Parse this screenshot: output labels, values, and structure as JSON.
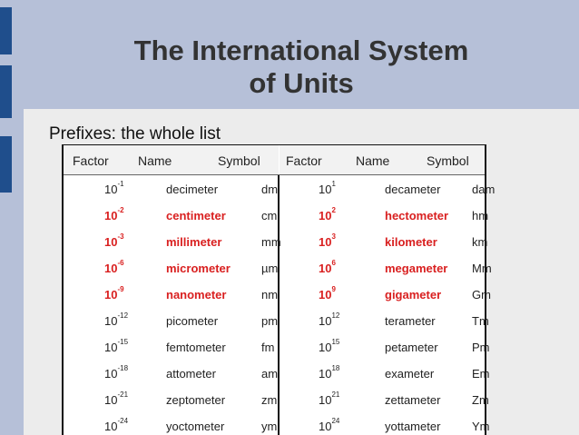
{
  "title": "The International System of Units",
  "title_lines": [
    "The International System",
    "of Units"
  ],
  "subtitle": "Prefixes: the whole list",
  "headers": [
    "Factor",
    "Name",
    "Symbol",
    "Factor",
    "Name",
    "Symbol"
  ],
  "colors": {
    "highlight": "#d92020",
    "text": "#222222",
    "band": "#b6c0d8",
    "marker": "#1f4e8c"
  },
  "rows": [
    {
      "highlight": false,
      "left": {
        "base": "10",
        "exp": "-1",
        "name": "decimeter",
        "symbol": "dm"
      },
      "right": {
        "base": "10",
        "exp": "1",
        "name": "decameter",
        "symbol": "dam"
      }
    },
    {
      "highlight": true,
      "left": {
        "base": "10",
        "exp": "-2",
        "name": "centimeter",
        "symbol": "cm"
      },
      "right": {
        "base": "10",
        "exp": "2",
        "name": "hectometer",
        "symbol": "hm"
      }
    },
    {
      "highlight": true,
      "left": {
        "base": "10",
        "exp": "-3",
        "name": "millimeter",
        "symbol": "mm"
      },
      "right": {
        "base": "10",
        "exp": "3",
        "name": "kilometer",
        "symbol": "km"
      }
    },
    {
      "highlight": true,
      "left": {
        "base": "10",
        "exp": "-6",
        "name": "micrometer",
        "symbol": "µm"
      },
      "right": {
        "base": "10",
        "exp": "6",
        "name": "megameter",
        "symbol": "Mm"
      }
    },
    {
      "highlight": true,
      "left": {
        "base": "10",
        "exp": "-9",
        "name": "nanometer",
        "symbol": "nm"
      },
      "right": {
        "base": "10",
        "exp": "9",
        "name": "gigameter",
        "symbol": "Gm"
      }
    },
    {
      "highlight": false,
      "left": {
        "base": "10",
        "exp": "-12",
        "name": "picometer",
        "symbol": "pm"
      },
      "right": {
        "base": "10",
        "exp": "12",
        "name": "terameter",
        "symbol": "Tm"
      }
    },
    {
      "highlight": false,
      "left": {
        "base": "10",
        "exp": "-15",
        "name": "femtometer",
        "symbol": "fm"
      },
      "right": {
        "base": "10",
        "exp": "15",
        "name": "petameter",
        "symbol": "Pm"
      }
    },
    {
      "highlight": false,
      "left": {
        "base": "10",
        "exp": "-18",
        "name": "attometer",
        "symbol": "am"
      },
      "right": {
        "base": "10",
        "exp": "18",
        "name": "exameter",
        "symbol": "Em"
      }
    },
    {
      "highlight": false,
      "left": {
        "base": "10",
        "exp": "-21",
        "name": "zeptometer",
        "symbol": "zm"
      },
      "right": {
        "base": "10",
        "exp": "21",
        "name": "zettameter",
        "symbol": "Zm"
      }
    },
    {
      "highlight": false,
      "left": {
        "base": "10",
        "exp": "-24",
        "name": "yoctometer",
        "symbol": "ym"
      },
      "right": {
        "base": "10",
        "exp": "24",
        "name": "yottameter",
        "symbol": "Ym"
      }
    }
  ]
}
